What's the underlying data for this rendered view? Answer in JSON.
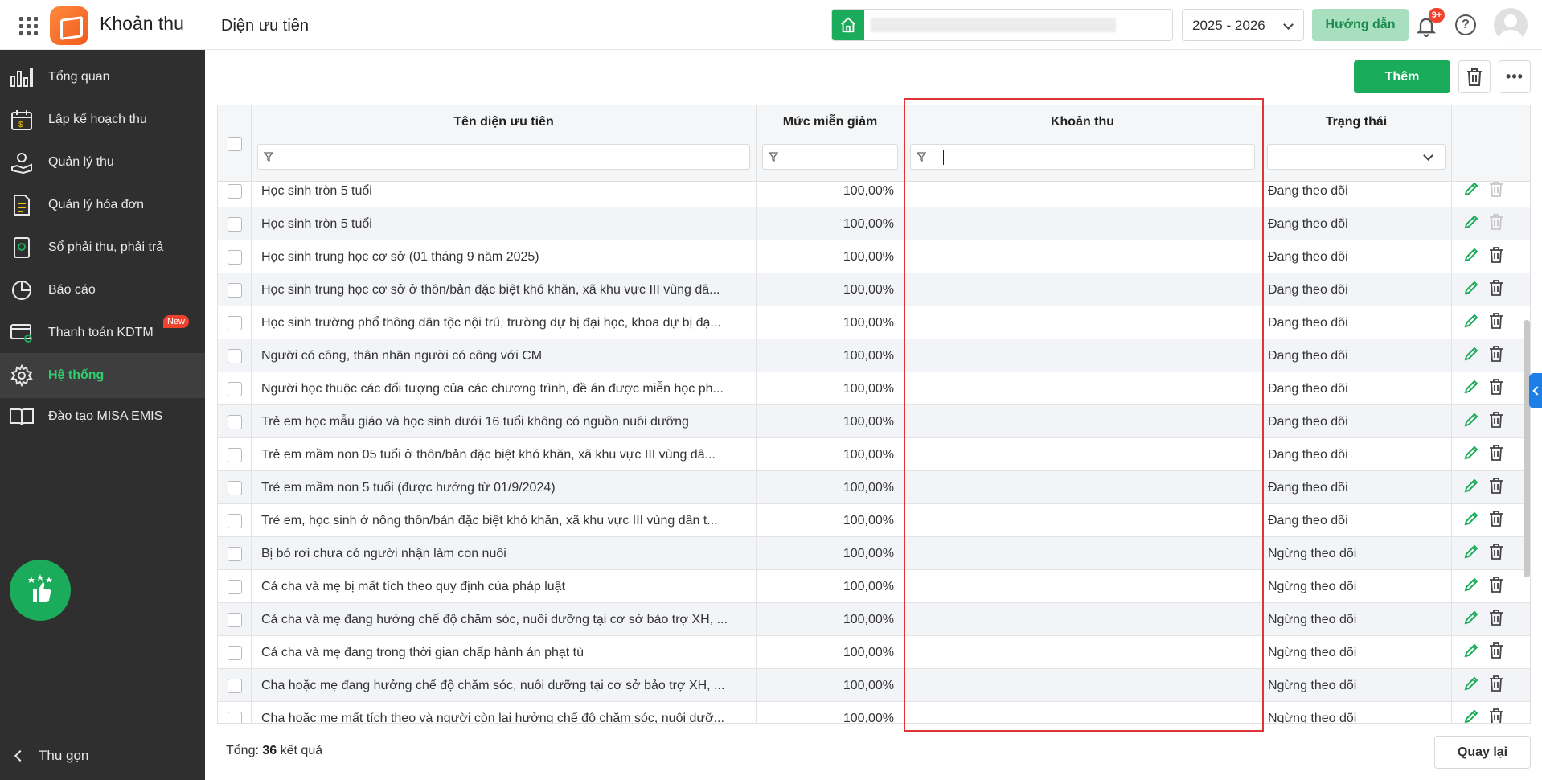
{
  "header": {
    "app_name": "Khoản thu",
    "page_title": "Diện ưu tiên",
    "school_year": "2025 - 2026",
    "guide_label": "Hướng dẫn",
    "notification_badge": "9+",
    "help_label": "?"
  },
  "sidebar": {
    "items": [
      {
        "label": "Tổng quan",
        "icon": "chart-bars-icon"
      },
      {
        "label": "Lập kế hoạch thu",
        "icon": "calendar-money-icon"
      },
      {
        "label": "Quản lý thu",
        "icon": "hand-coin-icon"
      },
      {
        "label": "Quản lý hóa đơn",
        "icon": "invoice-icon"
      },
      {
        "label": "Sổ phải thu, phải trả",
        "icon": "ledger-book-icon"
      },
      {
        "label": "Báo cáo",
        "icon": "pie-chart-icon"
      },
      {
        "label": "Thanh toán KDTM",
        "icon": "card-payment-icon",
        "badge": "New"
      },
      {
        "label": "Hệ thống",
        "icon": "gear-icon",
        "active": true
      },
      {
        "label": "Đào tạo MISA EMIS",
        "icon": "open-book-icon"
      }
    ],
    "collapse_label": "Thu gọn"
  },
  "toolbar": {
    "add_label": "Thêm",
    "more_label": "•••"
  },
  "table": {
    "columns": [
      "Tên diện ưu tiên",
      "Mức miễn giảm",
      "Khoản thu",
      "Trạng thái"
    ],
    "rows": [
      {
        "name": "Học sinh tròn 5 tuổi",
        "rate": "100,00%",
        "fee": "",
        "status": "Đang theo dõi",
        "delete_disabled": true
      },
      {
        "name": "Học sinh tròn 5 tuổi",
        "rate": "100,00%",
        "fee": "",
        "status": "Đang theo dõi",
        "delete_disabled": true
      },
      {
        "name": "Học sinh trung học cơ sở (01 tháng 9 năm 2025)",
        "rate": "100,00%",
        "fee": "",
        "status": "Đang theo dõi"
      },
      {
        "name": "Học sinh trung học cơ sở ở thôn/bản đặc biệt khó khăn, xã khu vực III vùng dâ...",
        "rate": "100,00%",
        "fee": "",
        "status": "Đang theo dõi"
      },
      {
        "name": "Học sinh trường phổ thông dân tộc nội trú, trường dự bị đại học, khoa dự bị đạ...",
        "rate": "100,00%",
        "fee": "",
        "status": "Đang theo dõi"
      },
      {
        "name": "Người có công, thân nhân người có công với CM",
        "rate": "100,00%",
        "fee": "",
        "status": "Đang theo dõi"
      },
      {
        "name": "Người học thuộc các đối tượng của các chương trình, đề án được miễn học ph...",
        "rate": "100,00%",
        "fee": "",
        "status": "Đang theo dõi"
      },
      {
        "name": "Trẻ em học mẫu giáo và học sinh dưới 16 tuổi không có nguồn nuôi dưỡng",
        "rate": "100,00%",
        "fee": "",
        "status": "Đang theo dõi"
      },
      {
        "name": "Trẻ em mầm non 05 tuổi ở thôn/bản đặc biệt khó khăn, xã khu vực III vùng dâ...",
        "rate": "100,00%",
        "fee": "",
        "status": "Đang theo dõi"
      },
      {
        "name": "Trẻ em mầm non 5 tuổi (được hưởng từ 01/9/2024)",
        "rate": "100,00%",
        "fee": "",
        "status": "Đang theo dõi"
      },
      {
        "name": "Trẻ em, học sinh ở nông thôn/bản đặc biệt khó khăn, xã khu vực III vùng dân t...",
        "rate": "100,00%",
        "fee": "",
        "status": "Đang theo dõi"
      },
      {
        "name": "Bị bỏ rơi chưa có người nhận làm con nuôi",
        "rate": "100,00%",
        "fee": "",
        "status": "Ngừng theo dõi"
      },
      {
        "name": "Cả cha và mẹ bị mất tích theo quy định của pháp luật",
        "rate": "100,00%",
        "fee": "",
        "status": "Ngừng theo dõi"
      },
      {
        "name": "Cả cha và mẹ đang hưởng chế độ chăm sóc, nuôi dưỡng tại cơ sở bảo trợ XH, ...",
        "rate": "100,00%",
        "fee": "",
        "status": "Ngừng theo dõi"
      },
      {
        "name": "Cả cha và mẹ đang trong thời gian chấp hành án phạt tù",
        "rate": "100,00%",
        "fee": "",
        "status": "Ngừng theo dõi"
      },
      {
        "name": "Cha hoặc mẹ đang hưởng chế độ chăm sóc, nuôi dưỡng tại cơ sở bảo trợ XH, ...",
        "rate": "100,00%",
        "fee": "",
        "status": "Ngừng theo dõi"
      },
      {
        "name": "Cha hoặc mẹ mất tích theo và người còn lại hưởng chế độ chăm sóc, nuôi dưỡ...",
        "rate": "100,00%",
        "fee": "",
        "status": "Ngừng theo dõi"
      }
    ]
  },
  "footer": {
    "total_prefix": "Tổng:",
    "total_count": "36",
    "total_suffix": "kết quả",
    "back_label": "Quay lại"
  },
  "colors": {
    "brand_green": "#1aab5b",
    "sidebar_bg": "#2f2f2f",
    "highlight_red": "#e0343b",
    "badge_red": "#f0432d"
  }
}
